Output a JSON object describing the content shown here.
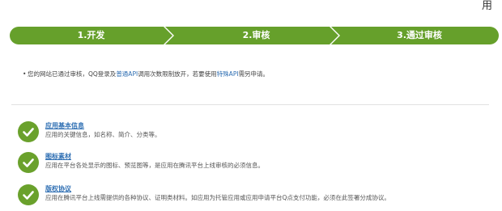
{
  "corner_text": "用",
  "steps": [
    {
      "label": "1.开发"
    },
    {
      "label": "2.审核"
    },
    {
      "label": "3.通过审核"
    }
  ],
  "colors": {
    "accent": "#66a02b",
    "link": "#2f6fb3"
  },
  "notice": {
    "part1": "您的网站已通过审核，QQ登录及",
    "link1": "普通API",
    "part2": "调用次数限制放开，若要使用",
    "link2": "特殊API",
    "part3": "需另申请。"
  },
  "items": [
    {
      "icon": "check-icon",
      "title": "应用基本信息",
      "desc": "应用的关键信息，如名称、简介、分类等。"
    },
    {
      "icon": "check-icon",
      "title": "图标素材",
      "desc": "应用在平台各处显示的图标、预览图等，是应用在腾讯平台上线审核的必须信息。"
    },
    {
      "icon": "check-icon",
      "title": "版权协议",
      "desc": "应用在腾讯平台上线需提供的各种协议、证明类材料。如应用为托管应用或应用申请平台Q点支付功能，必须在此签署分成协议。"
    }
  ]
}
